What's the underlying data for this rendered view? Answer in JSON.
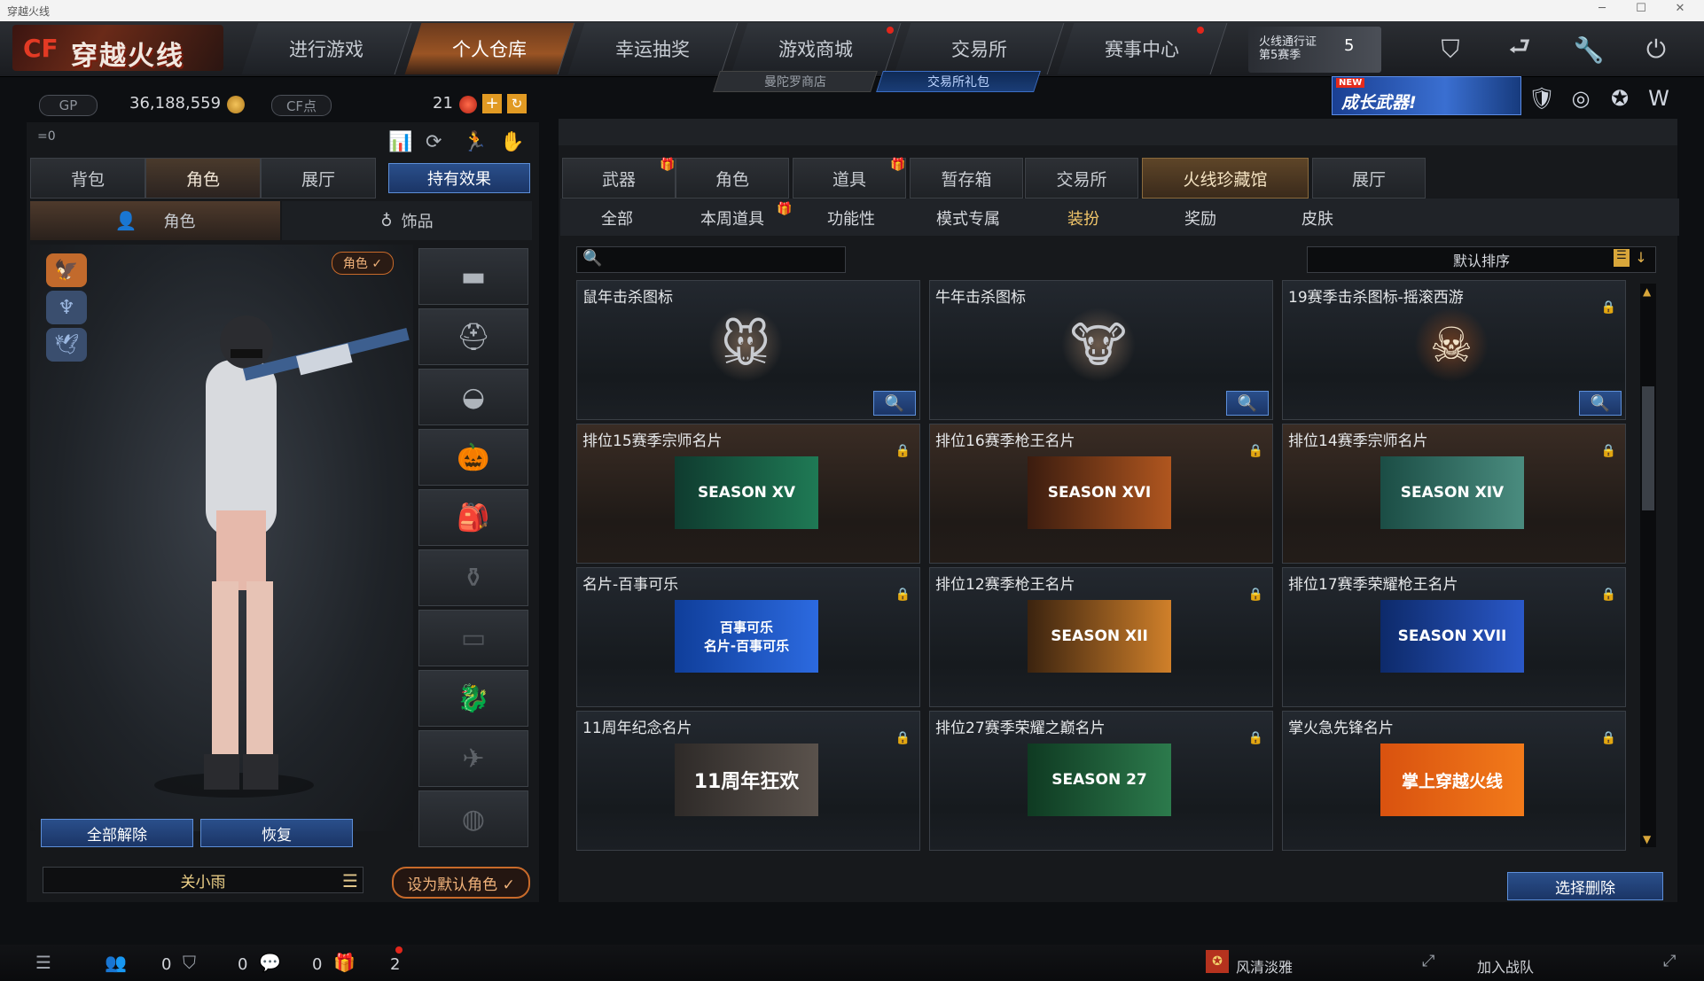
{
  "window": {
    "title": "穿越火线"
  },
  "logo": {
    "text": "穿越火线",
    "mark": "CF"
  },
  "nav": {
    "tabs": [
      {
        "label": "进行游戏"
      },
      {
        "label": "个人仓库"
      },
      {
        "label": "幸运抽奖"
      },
      {
        "label": "游戏商城"
      },
      {
        "label": "交易所"
      },
      {
        "label": "赛事中心"
      }
    ],
    "sub": {
      "left": "曼陀罗商店",
      "right": "交易所礼包"
    },
    "pass_label": "火线通行证\n第5赛季",
    "pass_level": "5"
  },
  "currency": {
    "gp_label": "GP",
    "gp_value": "36,188,559",
    "cf_label": "CF点",
    "cf_value": "21",
    "level_indicator": "=0"
  },
  "banner": {
    "new_label": "NEW",
    "text": "成长武器!"
  },
  "left": {
    "tabs": [
      "背包",
      "角色",
      "展厅"
    ],
    "effect_button": "持有效果",
    "subtabs": [
      "角色",
      "饰品"
    ],
    "role_badge": "角色 ✓",
    "unequip_all": "全部解除",
    "restore": "恢复",
    "character_name": "关小雨",
    "set_default": "设为默认角色 ✓"
  },
  "right": {
    "tabs": [
      "武器",
      "角色",
      "道具",
      "暂存箱",
      "交易所",
      "火线珍藏馆",
      "展厅"
    ],
    "subtabs": [
      "全部",
      "本周道具",
      "功能性",
      "模式专属",
      "装扮",
      "奖励",
      "皮肤"
    ],
    "sort_label": "默认排序",
    "search_placeholder": "",
    "cards": [
      {
        "title": "鼠年击杀图标",
        "art": "🐭"
      },
      {
        "title": "牛年击杀图标",
        "art": "🐮"
      },
      {
        "title": "19赛季击杀图标-摇滚西游",
        "art": "☠"
      },
      {
        "title": "排位15赛季宗师名片",
        "art": "SEASON XV"
      },
      {
        "title": "排位16赛季枪王名片",
        "art": "SEASON XVI"
      },
      {
        "title": "排位14赛季宗师名片",
        "art": "SEASON XIV"
      },
      {
        "title": "名片-百事可乐",
        "art": "百事可乐\n名片-百事可乐"
      },
      {
        "title": "排位12赛季枪王名片",
        "art": "SEASON XII"
      },
      {
        "title": "排位17赛季荣耀枪王名片",
        "art": "SEASON XVII"
      },
      {
        "title": "11周年纪念名片",
        "art": "11周年狂欢"
      },
      {
        "title": "排位27赛季荣耀之巅名片",
        "art": "SEASON 27"
      },
      {
        "title": "掌火急先锋名片",
        "art": "掌上穿越火线"
      }
    ],
    "delete_button": "选择删除"
  },
  "bottom": {
    "count1": "0",
    "count2": "0",
    "count3": "0",
    "count4": "2",
    "clan_name": "风清淡雅",
    "join_team": "加入战队"
  },
  "colors": {
    "accent_blue": "#2a4f8b",
    "accent_orange": "#c86a2a",
    "gold": "#f2c66a"
  }
}
